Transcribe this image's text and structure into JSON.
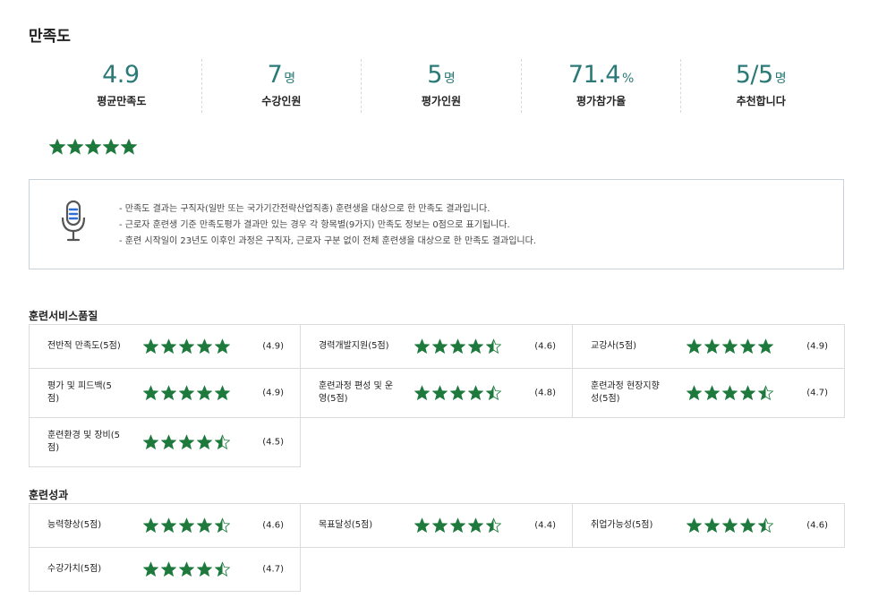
{
  "page_title": "만족도",
  "stats": [
    {
      "value": "4.9",
      "unit": "",
      "label": "평균만족도"
    },
    {
      "value": "7",
      "unit": "명",
      "label": "수강인원"
    },
    {
      "value": "5",
      "unit": "명",
      "label": "평가인원"
    },
    {
      "value": "71.4",
      "unit": "%",
      "label": "평가참가율"
    },
    {
      "value": "5/5",
      "unit": "명",
      "label": "추천합니다"
    }
  ],
  "overall_star_rating": 5,
  "notice": {
    "icon": "microphone-icon",
    "lines": [
      "- 만족도 결과는 구직자(일반 또는 국가기간전략산업직종) 훈련생을 대상으로 한 만족도 결과입니다.",
      "- 근로자 훈련생 기준 만족도평가 결과만 있는 경우 각 항목별(9가지) 만족도 정보는 0점으로 표기됩니다.",
      "- 훈련 시작일이 23년도 이후인 과정은 구직자, 근로자 구분 없이 전체 훈련생을 대상으로 한 만족도 결과입니다."
    ]
  },
  "sections": [
    {
      "title": "훈련서비스품질",
      "items": [
        {
          "name": "전반적 만족도(5점)",
          "rating": 4.9,
          "score": "(4.9)"
        },
        {
          "name": "경력개발지원(5점)",
          "rating": 4.6,
          "score": "(4.6)"
        },
        {
          "name": "교강사(5점)",
          "rating": 4.9,
          "score": "(4.9)"
        },
        {
          "name": "평가 및 피드백(5점)",
          "rating": 4.9,
          "score": "(4.9)"
        },
        {
          "name": "훈련과정 편성 및 운영(5점)",
          "rating": 4.8,
          "score": "(4.8)"
        },
        {
          "name": "훈련과정 현장지향성(5점)",
          "rating": 4.7,
          "score": "(4.7)"
        },
        {
          "name": "훈련환경 및 장비(5점)",
          "rating": 4.5,
          "score": "(4.5)"
        }
      ]
    },
    {
      "title": "훈련성과",
      "items": [
        {
          "name": "능력향상(5점)",
          "rating": 4.6,
          "score": "(4.6)"
        },
        {
          "name": "목표달성(5점)",
          "rating": 4.4,
          "score": "(4.4)"
        },
        {
          "name": "취업가능성(5점)",
          "rating": 4.6,
          "score": "(4.6)"
        },
        {
          "name": "수강가치(5점)",
          "rating": 4.7,
          "score": "(4.7)"
        }
      ]
    }
  ],
  "colors": {
    "accent": "#2b7a78",
    "star": "#1e7a3c",
    "border": "#dcdcdc"
  }
}
